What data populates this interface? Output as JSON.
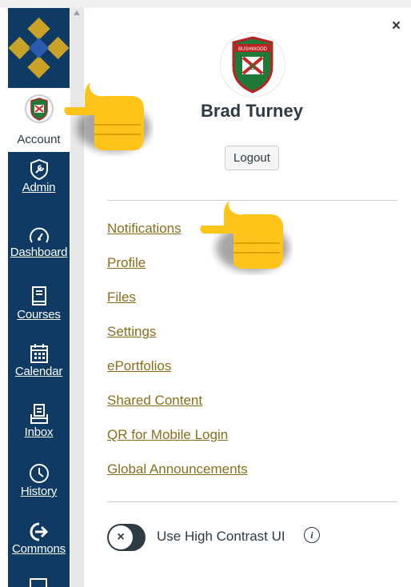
{
  "nav": {
    "account": {
      "label": "Account",
      "icon": "bushwood-avatar-icon"
    },
    "items": [
      {
        "label": "Admin",
        "icon": "wrench-shield-icon"
      },
      {
        "label": "Dashboard",
        "icon": "speedometer-icon"
      },
      {
        "label": "Courses",
        "icon": "book-icon"
      },
      {
        "label": "Calendar",
        "icon": "calendar-icon"
      },
      {
        "label": "Inbox",
        "icon": "inbox-icon"
      },
      {
        "label": "History",
        "icon": "clock-icon"
      },
      {
        "label": "Commons",
        "icon": "commons-arrow-icon"
      }
    ]
  },
  "tray": {
    "close_symbol": "×",
    "user_name": "Brad Turney",
    "logout_label": "Logout",
    "avatar_text": "BUSHWOOD",
    "avatar_letter": "B",
    "links": [
      "Notifications",
      "Profile",
      "Files",
      "Settings",
      "ePortfolios",
      "Shared Content",
      "QR for Mobile Login",
      "Global Announcements"
    ],
    "high_contrast": {
      "label": "Use High Contrast UI",
      "enabled": false,
      "knob_symbol": "×"
    },
    "info_symbol": "i"
  },
  "colors": {
    "nav_bg": "#0e3a63",
    "link": "#8a6e1c",
    "text": "#2d3b45",
    "logo_gold": "#c9a227",
    "logo_blue": "#2a5db0"
  }
}
